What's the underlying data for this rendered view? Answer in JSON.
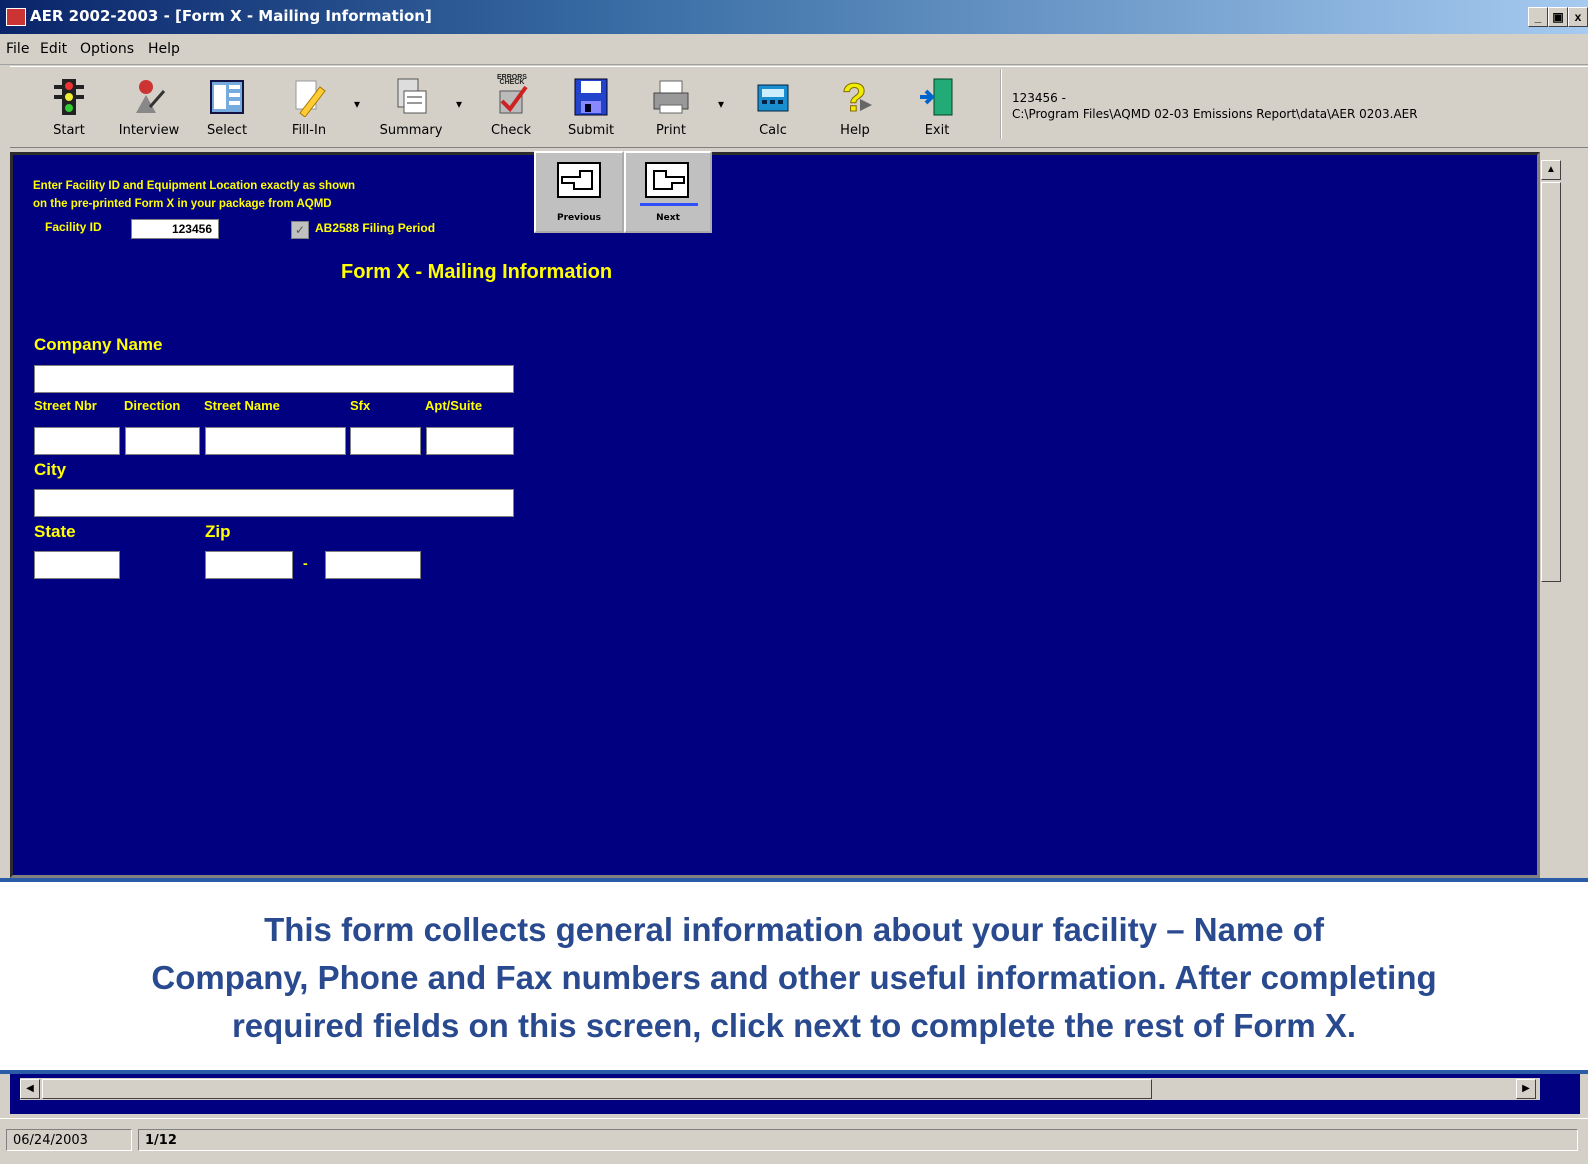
{
  "window": {
    "title": "AER 2002-2003 - [Form X - Mailing Information]",
    "controls": [
      "_",
      "ə",
      "x"
    ]
  },
  "menu": [
    "File",
    "Edit",
    "Options",
    "Help"
  ],
  "toolbar": {
    "buttons": [
      {
        "label": "Start",
        "icon": "traffic-light-icon"
      },
      {
        "label": "Interview",
        "icon": "interview-icon"
      },
      {
        "label": "Select",
        "icon": "select-list-icon"
      },
      {
        "label": "Fill-In",
        "icon": "pencil-icon"
      },
      {
        "label": "Summary",
        "icon": "summary-icon"
      },
      {
        "label": "Check",
        "icon": "check-icon"
      },
      {
        "label": "Submit",
        "icon": "floppy-disk-icon"
      },
      {
        "label": "Print",
        "icon": "printer-icon"
      },
      {
        "label": "Calc",
        "icon": "calculator-icon"
      },
      {
        "label": "Help",
        "icon": "help-question-icon"
      },
      {
        "label": "Exit",
        "icon": "exit-door-icon"
      }
    ],
    "check_icon_text": "ERRORS CHECK",
    "path_line1": "123456 -",
    "path_line2": "C:\\Program Files\\AQMD 02-03 Emissions Report\\data\\AER 0203.AER"
  },
  "form": {
    "instruction_line1": "Enter Facility ID and Equipment Location exactly as shown",
    "instruction_line2": "on the pre-printed Form X in your package from AQMD",
    "facility_id_label": "Facility ID",
    "facility_id_value": "123456",
    "ab2588_label": "AB2588 Filing Period",
    "ab2588_checked": true,
    "nav_previous": "Previous",
    "nav_next": "Next",
    "title": "Form X - Mailing Information",
    "company_name_label": "Company Name",
    "company_name_value": "",
    "street_nbr_label": "Street Nbr",
    "direction_label": "Direction",
    "street_name_label": "Street Name",
    "sfx_label": "Sfx",
    "apt_suite_label": "Apt/Suite",
    "city_label": "City",
    "state_label": "State",
    "zip_label": "Zip",
    "zip_dash": "-"
  },
  "caption": "This form collects general information about your facility – Name of\nCompany, Phone and Fax numbers and other useful information.  After completing\nrequired fields on this screen, click next to complete the rest of Form X.",
  "status": {
    "date": "06/24/2003",
    "page": "1/12"
  },
  "colors": {
    "form_background": "#000080",
    "label_yellow": "#ffff00",
    "caption_blue": "#2a4a8f"
  }
}
